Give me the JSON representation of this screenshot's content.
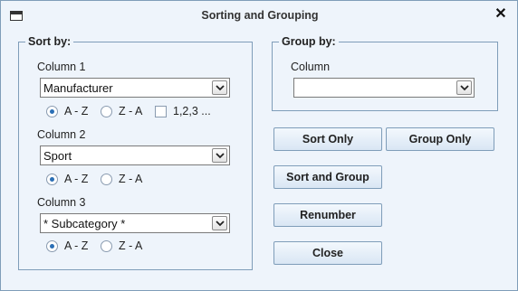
{
  "window": {
    "title": "Sorting and Grouping"
  },
  "sort": {
    "legend": "Sort by:",
    "columns": [
      {
        "label": "Column 1",
        "value": "Manufacturer",
        "asc": "A - Z",
        "desc": "Z - A",
        "numeric": "1,2,3 ...",
        "selected": "asc"
      },
      {
        "label": "Column 2",
        "value": "Sport",
        "asc": "A - Z",
        "desc": "Z - A",
        "selected": "asc"
      },
      {
        "label": "Column 3",
        "value": "* Subcategory *",
        "asc": "A - Z",
        "desc": "Z - A",
        "selected": "asc"
      }
    ]
  },
  "group": {
    "legend": "Group by:",
    "column_label": "Column",
    "value": ""
  },
  "buttons": {
    "sort_only": "Sort Only",
    "group_only": "Group Only",
    "sort_and_group": "Sort and Group",
    "renumber": "Renumber",
    "close": "Close"
  }
}
